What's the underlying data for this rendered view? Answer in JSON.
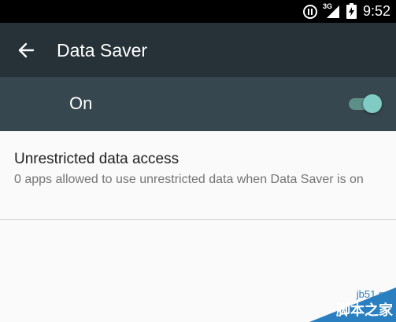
{
  "status_bar": {
    "time": "9:52",
    "network": "3G",
    "icons": [
      "pause-circle-icon",
      "signal-icon",
      "battery-charging-icon"
    ]
  },
  "app_bar": {
    "title": "Data Saver",
    "back_icon": "arrow-back-icon"
  },
  "switch_bar": {
    "label": "On",
    "enabled": true
  },
  "settings": [
    {
      "title": "Unrestricted data access",
      "summary": "0 apps allowed to use unrestricted data when Data Saver is on"
    }
  ],
  "watermark": {
    "top": "jb51.net",
    "bottom": "脚本之家"
  },
  "colors": {
    "status_bar": "#000000",
    "app_bar": "#263238",
    "switch_bar": "#37474f",
    "toggle_thumb": "#80cbc4",
    "background": "#fafafa",
    "watermark": "#2a7fc0"
  }
}
